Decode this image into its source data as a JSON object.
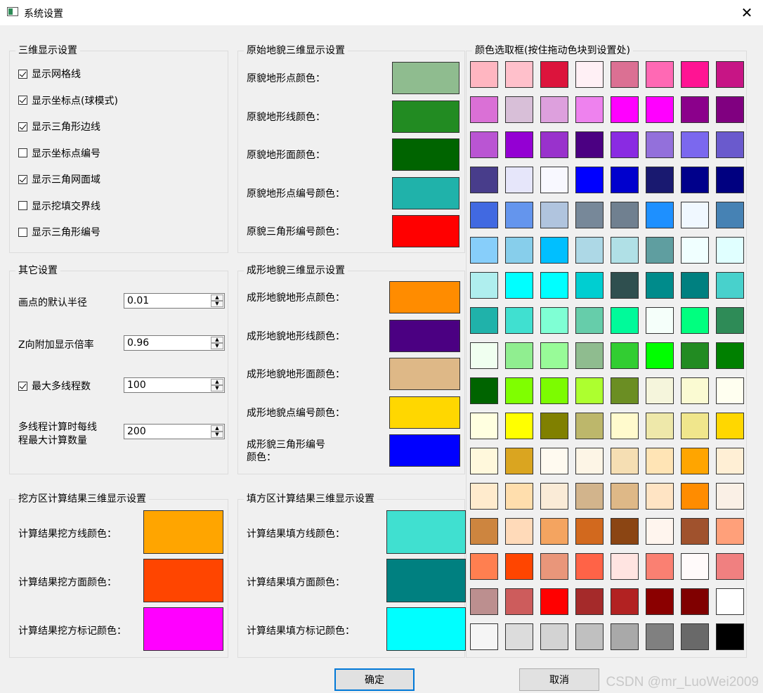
{
  "window": {
    "title": "系统设置"
  },
  "display3d": {
    "title": "三维显示设置",
    "items": [
      {
        "label": "显示网格线",
        "checked": true
      },
      {
        "label": "显示坐标点(球模式)",
        "checked": true
      },
      {
        "label": "显示三角形边线",
        "checked": true
      },
      {
        "label": "显示坐标点编号",
        "checked": false
      },
      {
        "label": "显示三角网面域",
        "checked": true
      },
      {
        "label": "显示挖填交界线",
        "checked": false
      },
      {
        "label": "显示三角形编号",
        "checked": false
      }
    ]
  },
  "other": {
    "title": "其它设置",
    "radius_label": "画点的默认半径",
    "radius_value": "0.01",
    "zscale_label": "Z向附加显示倍率",
    "zscale_value": "0.96",
    "threads_label": "最大多线程数",
    "threads_checked": true,
    "threads_value": "100",
    "batch_label_1": "多线程计算时每线",
    "batch_label_2": "程最大计算数量",
    "batch_value": "200"
  },
  "original": {
    "title": "原始地貌三维显示设置",
    "items": [
      {
        "label": "原貌地形点颜色：",
        "color": "#8fbc8f"
      },
      {
        "label": "原貌地形线颜色：",
        "color": "#228b22"
      },
      {
        "label": "原貌地形面颜色：",
        "color": "#006400"
      },
      {
        "label": "原貌地形点编号颜色：",
        "color": "#20b2aa"
      },
      {
        "label": "原貌三角形编号颜色：",
        "color": "#ff0000"
      }
    ]
  },
  "formed": {
    "title": "成形地貌三维显示设置",
    "items": [
      {
        "label": "成形地貌地形点颜色：",
        "color": "#ff8c00"
      },
      {
        "label": "成形地貌地形线颜色：",
        "color": "#4b0082"
      },
      {
        "label": "成形地貌地形面颜色：",
        "color": "#deb887"
      },
      {
        "label": "成形地貌点编号颜色：",
        "color": "#ffd700"
      },
      {
        "label_1": "成形貌三角形编号",
        "label_2": "颜色：",
        "color": "#0000ff"
      }
    ]
  },
  "cut": {
    "title": "挖方区计算结果三维显示设置",
    "items": [
      {
        "label": "计算结果挖方线颜色：",
        "color": "#ffa500"
      },
      {
        "label": "计算结果挖方面颜色：",
        "color": "#ff4500"
      },
      {
        "label": "计算结果挖方标记颜色：",
        "color": "#ff00ff"
      }
    ]
  },
  "fill": {
    "title": "填方区计算结果三维显示设置",
    "items": [
      {
        "label": "计算结果填方线颜色：",
        "color": "#40e0d0"
      },
      {
        "label": "计算结果填方面颜色：",
        "color": "#008080"
      },
      {
        "label": "计算结果填方标记颜色：",
        "color": "#00ffff"
      }
    ]
  },
  "palette": {
    "title": "颜色选取框(按住拖动色块到设置处)",
    "rows": [
      [
        "#ffb6c1",
        "#ffc0cb",
        "#dc143c",
        "#fff0f5",
        "#db7093",
        "#ff69b4",
        "#ff1493",
        "#c71585"
      ],
      [
        "#da70d6",
        "#d8bfd8",
        "#dda0dd",
        "#ee82ee",
        "#ff00ff",
        "#ff00ff",
        "#8b008b",
        "#800080"
      ],
      [
        "#ba55d3",
        "#9400d3",
        "#9932cc",
        "#4b0082",
        "#8a2be2",
        "#9370db",
        "#7b68ee",
        "#6a5acd"
      ],
      [
        "#483d8b",
        "#e6e6fa",
        "#f8f8ff",
        "#0000ff",
        "#0000cd",
        "#191970",
        "#00008b",
        "#000080"
      ],
      [
        "#4169e1",
        "#6495ed",
        "#b0c4de",
        "#778899",
        "#708090",
        "#1e90ff",
        "#f0f8ff",
        "#4682b4"
      ],
      [
        "#87cefa",
        "#87ceeb",
        "#00bfff",
        "#add8e6",
        "#b0e0e6",
        "#5f9ea0",
        "#f0ffff",
        "#e0ffff"
      ],
      [
        "#afeeee",
        "#00ffff",
        "#00ffff",
        "#00ced1",
        "#2f4f4f",
        "#008b8b",
        "#008080",
        "#48d1cc"
      ],
      [
        "#20b2aa",
        "#40e0d0",
        "#7fffd4",
        "#66cdaa",
        "#00fa9a",
        "#f5fffa",
        "#00ff7f",
        "#2e8b57"
      ],
      [
        "#f0fff0",
        "#90ee90",
        "#98fb98",
        "#8fbc8f",
        "#32cd32",
        "#00ff00",
        "#228b22",
        "#008000"
      ],
      [
        "#006400",
        "#7fff00",
        "#7cfc00",
        "#adff2f",
        "#6b8e23",
        "#f5f5dc",
        "#fafad2",
        "#fffff0"
      ],
      [
        "#ffffe0",
        "#ffff00",
        "#808000",
        "#bdb76b",
        "#fffacd",
        "#eee8aa",
        "#f0e68c",
        "#ffd700"
      ],
      [
        "#fff8dc",
        "#daa520",
        "#fffaf0",
        "#fdf5e6",
        "#f5deb3",
        "#ffe4b5",
        "#ffa500",
        "#ffefd5"
      ],
      [
        "#ffebcd",
        "#ffdead",
        "#faebd7",
        "#d2b48c",
        "#deb887",
        "#ffe4c4",
        "#ff8c00",
        "#faf0e6"
      ],
      [
        "#cd853f",
        "#ffdab9",
        "#f4a460",
        "#d2691e",
        "#8b4513",
        "#fff5ee",
        "#a0522d",
        "#ffa07a"
      ],
      [
        "#ff7f50",
        "#ff4500",
        "#e9967a",
        "#ff6347",
        "#ffe4e1",
        "#fa8072",
        "#fffafa",
        "#f08080"
      ],
      [
        "#bc8f8f",
        "#cd5c5c",
        "#ff0000",
        "#a52a2a",
        "#b22222",
        "#8b0000",
        "#800000",
        "#ffffff"
      ],
      [
        "#f5f5f5",
        "#dcdcdc",
        "#d3d3d3",
        "#c0c0c0",
        "#a9a9a9",
        "#808080",
        "#696969",
        "#000000"
      ]
    ]
  },
  "buttons": {
    "ok": "确定",
    "cancel": "取消"
  },
  "watermark": "CSDN @mr_LuoWei2009"
}
